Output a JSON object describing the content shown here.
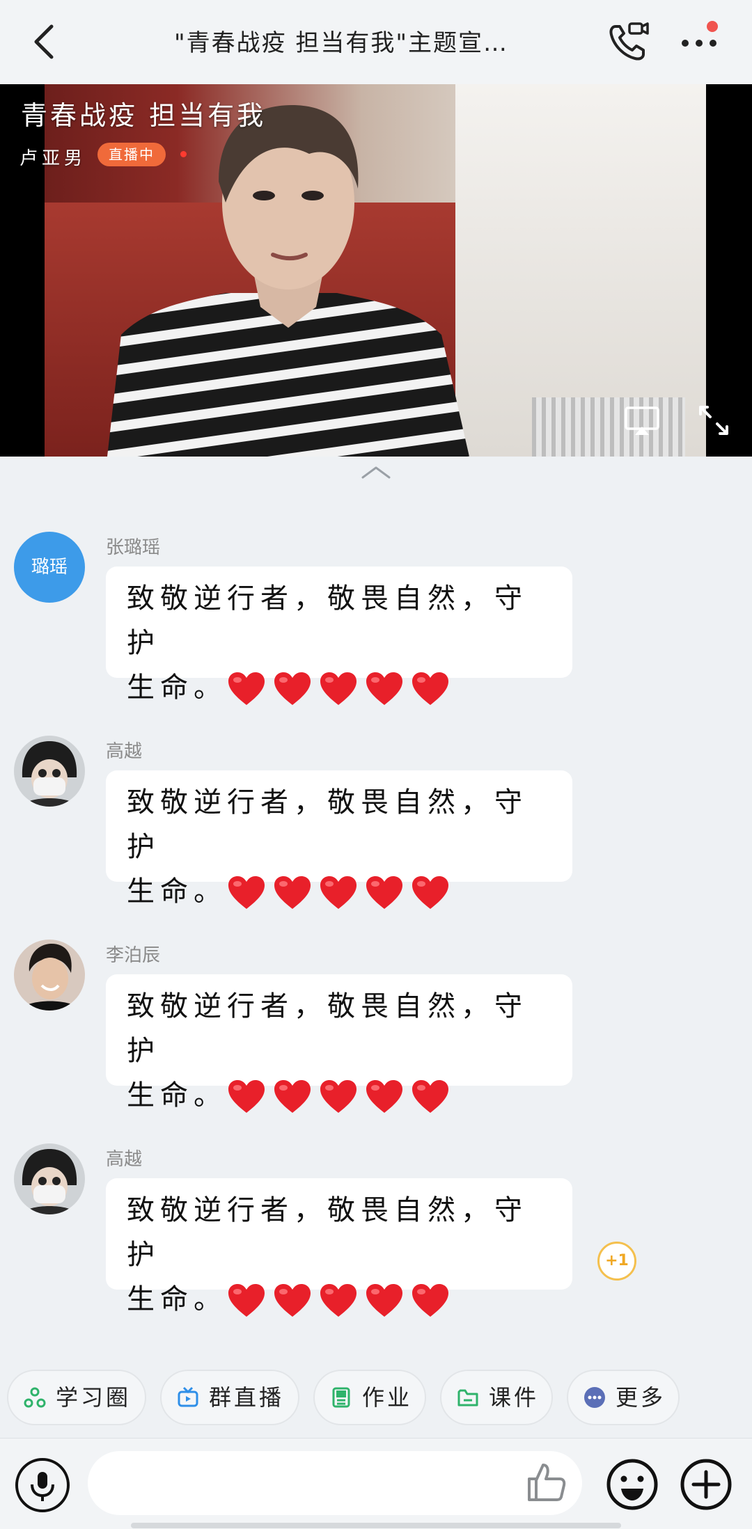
{
  "header": {
    "title": "\"青春战疫 担当有我\"主题宣…",
    "icons": [
      "back-icon",
      "video-call-icon",
      "more-icon"
    ],
    "notification_color": "#f0544f"
  },
  "live": {
    "title": "青春战疫 担当有我",
    "host": "卢亚男",
    "status": "直播中",
    "badge_color": "#f06a3a"
  },
  "messages": [
    {
      "sender": "张璐瑶",
      "avatar_text": "璐瑶",
      "text_line1": "致敬逆行者，敬畏自然，守护",
      "text_line2": "生命。",
      "hearts": 5
    },
    {
      "sender": "高越",
      "avatar_text": "",
      "text_line1": "致敬逆行者，敬畏自然，守护",
      "text_line2": "生命。",
      "hearts": 5
    },
    {
      "sender": "李泊辰",
      "avatar_text": "",
      "text_line1": "致敬逆行者，敬畏自然，守护",
      "text_line2": "生命。",
      "hearts": 5
    },
    {
      "sender": "高越",
      "avatar_text": "",
      "text_line1": "致敬逆行者，敬畏自然，守护",
      "text_line2": "生命。",
      "hearts": 5
    }
  ],
  "plus_one": "+1",
  "toolbar": [
    {
      "label": "学习圈",
      "icon": "study-circle-icon",
      "color": "#2fb36b"
    },
    {
      "label": "群直播",
      "icon": "group-live-icon",
      "color": "#2f8fe8"
    },
    {
      "label": "作业",
      "icon": "homework-icon",
      "color": "#2fb36b"
    },
    {
      "label": "课件",
      "icon": "courseware-icon",
      "color": "#2fb36b"
    },
    {
      "label": "更多",
      "icon": "more-dots-icon",
      "color": "#5b6fb7"
    }
  ],
  "input": {
    "placeholder": "",
    "icons": [
      "microphone-icon",
      "thumbs-up-icon",
      "emoji-icon",
      "plus-icon"
    ]
  }
}
